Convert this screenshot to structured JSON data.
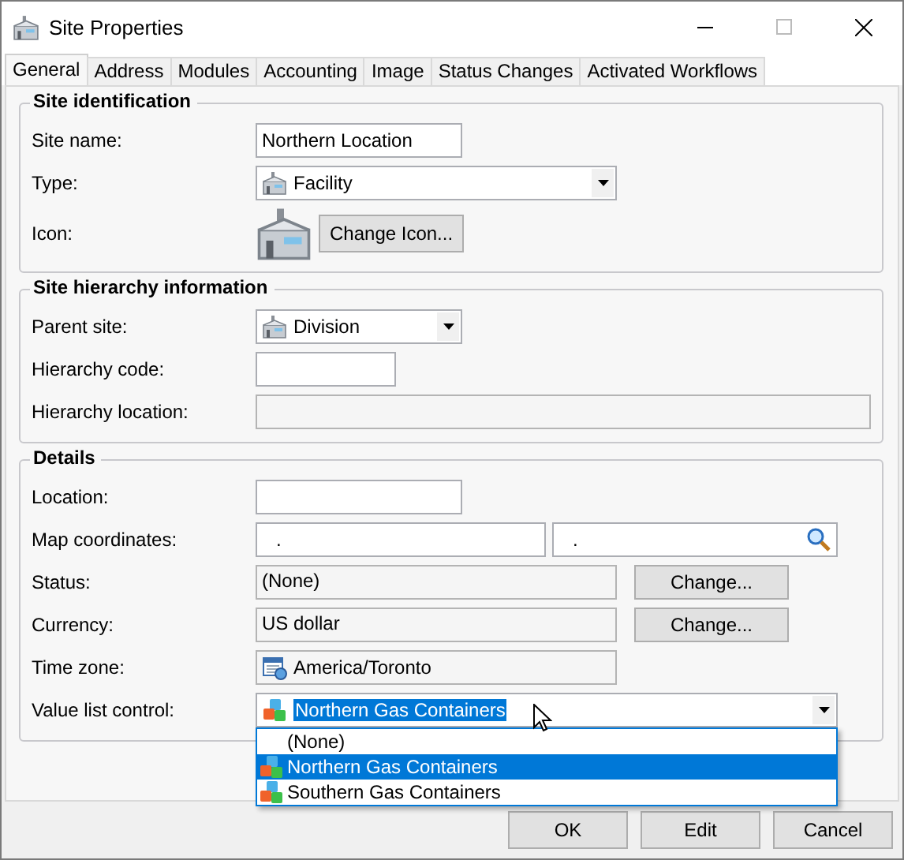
{
  "window": {
    "title": "Site Properties"
  },
  "tabs": [
    {
      "label": "General",
      "selected": true
    },
    {
      "label": "Address",
      "selected": false
    },
    {
      "label": "Modules",
      "selected": false
    },
    {
      "label": "Accounting",
      "selected": false
    },
    {
      "label": "Image",
      "selected": false
    },
    {
      "label": "Status Changes",
      "selected": false
    },
    {
      "label": "Activated Workflows",
      "selected": false
    }
  ],
  "sections": [
    {
      "title": "Site identification",
      "rows": [
        {
          "kind": "text",
          "label": "Site name:",
          "value": "Northern Location"
        },
        {
          "kind": "combo",
          "label": "Type:",
          "value": "Facility"
        },
        {
          "kind": "icon",
          "label": "Icon:",
          "button": "Change Icon..."
        }
      ]
    },
    {
      "title": "Site hierarchy information",
      "rows": [
        {
          "kind": "combo",
          "label": "Parent site:",
          "value": "Division"
        },
        {
          "kind": "text",
          "label": "Hierarchy code:"
        },
        {
          "kind": "readonly",
          "label": "Hierarchy location:"
        }
      ]
    },
    {
      "title": "Details",
      "rows": [
        {
          "kind": "text",
          "label": "Location:"
        },
        {
          "kind": "coords",
          "label": "Map coordinates:",
          "values": [
            ".",
            "."
          ]
        },
        {
          "kind": "readonly",
          "label": "Status:",
          "value": "(None)",
          "button": "Change..."
        },
        {
          "kind": "readonly",
          "label": "Currency:",
          "value": "US dollar",
          "button": "Change..."
        },
        {
          "kind": "timezone",
          "label": "Time zone:",
          "value": "America/Toronto"
        },
        {
          "kind": "dropdown",
          "label": "Value list control:",
          "value": "Northern Gas Containers",
          "options": [
            {
              "label": "(None)",
              "icon": false,
              "selected": false
            },
            {
              "label": "Northern Gas Containers",
              "icon": true,
              "selected": true
            },
            {
              "label": "Southern Gas Containers",
              "icon": true,
              "selected": false
            }
          ]
        }
      ]
    }
  ],
  "buttons": [
    "OK",
    "Edit",
    "Cancel"
  ]
}
